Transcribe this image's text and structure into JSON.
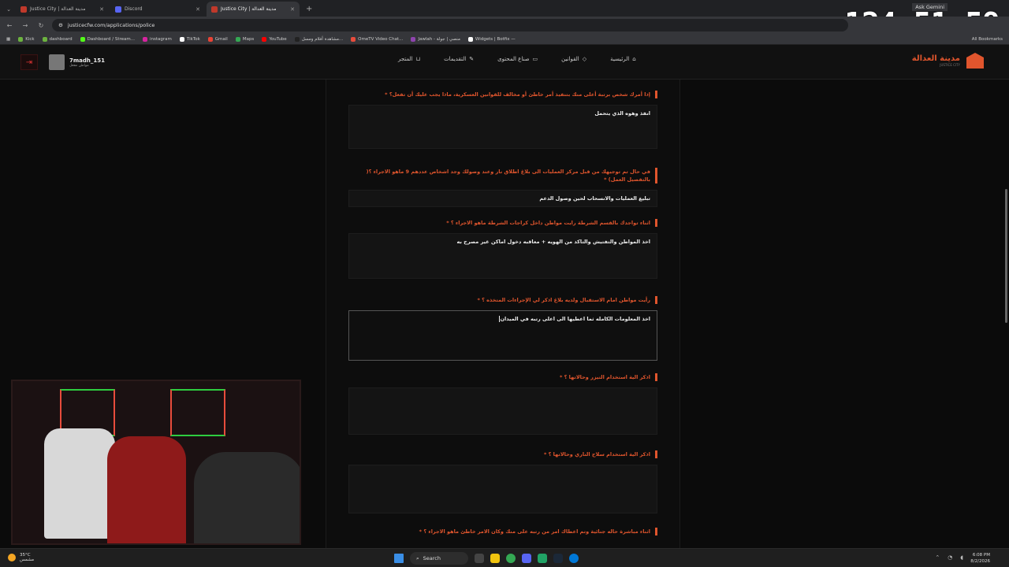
{
  "browser": {
    "tabs": [
      {
        "label": "Justice City | مدينة العدالة",
        "active": false
      },
      {
        "label": "Discord",
        "active": false
      },
      {
        "label": "Justice City | مدينة العدالة",
        "active": true
      }
    ],
    "new_tab_icon": "plus-icon",
    "url": "justicecfw.com/applications/police",
    "bookmarks": [
      "Kick",
      "dashboard",
      "Dashboard / Stream...",
      "instagram",
      "TikTok",
      "Gmail",
      "Maps",
      "YouTube",
      "مشاهدة أفلام ومسل...",
      "OmeTV Video Chat...",
      "Jawlah - منصي | جولة",
      "Widgets | Botfix —"
    ],
    "all_bookmarks": "All Bookmarks",
    "gemini": "Ask Gemini"
  },
  "stream_timer": "124:51:59",
  "site": {
    "brand": "مدينة العدالة",
    "brand_sub": "JUSTICE CITY",
    "username": "7madh_151",
    "user_role": "مواطن مفعل",
    "nav": [
      "الرئيسية",
      "القوانين",
      "صناع المحتوى",
      "التقديمات",
      "المتجر"
    ]
  },
  "questions": [
    {
      "label": "إذا أمرك شخص برتبة أعلى منك بتنفيذ أمر خاطئ أو مخالف للقوانين العسكرية، ماذا يجب عليك أن تفعل؟",
      "answer": "انفذ وهوه الذي يتحمل"
    },
    {
      "label": "في حال تم توجيهك من قبل مركز العمليات الى بلاغ اطلاق نار وعند وصولك وجد اشخاص عددهم 9 ماهو الاجراء ؟( بالتفصيل العمل)",
      "answer": "تبليغ العمليات والانسحاب لحين وصول الدعم"
    },
    {
      "label": "اثناء تواجدك بالقسم الشرطة رايت مواطن داخل كراجات الشرطة ماهو الاجراء ؟",
      "answer": "اخذ المواطن والتفتيش والتاكد من الهويه + معاقبه دخول اماكن غير مصرح به"
    },
    {
      "label": "رأيت مواطن امام الاستقبال ولديه بلاغ اذكر لي الإجراءات المتخذه ؟",
      "answer": "اخذ المعلومات الكامله ثما اعطيها الى اعلى رتبه في الميدان"
    },
    {
      "label": "اذكر الية استخدام التيزر وحالاتها ؟",
      "answer": ""
    },
    {
      "label": "اذكر الية استخدام سلاح الناري وحالاتها ؟",
      "answer": ""
    },
    {
      "label": "اثناء مباشرة حاله جنائية وتم اعطاك امر من رتبه على منك وكان الامر خاطئ ماهو الاجراء ؟",
      "answer": ""
    }
  ],
  "required_mark": "*",
  "taskbar": {
    "weather_temp": "35°C",
    "weather_desc": "مشمس",
    "search": "Search",
    "time": "6:08 PM",
    "date": "8/2/2026"
  }
}
